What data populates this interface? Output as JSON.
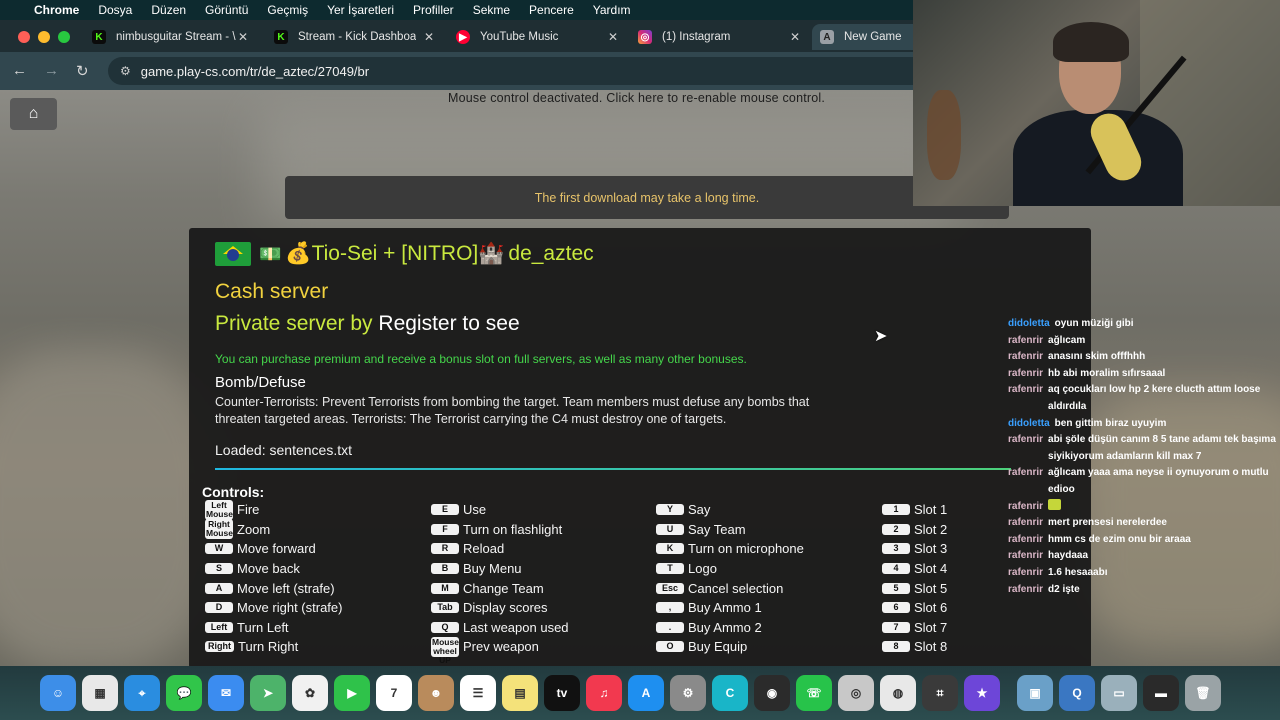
{
  "menubar": {
    "app": "Chrome",
    "items": [
      "Dosya",
      "Düzen",
      "Görüntü",
      "Geçmiş",
      "Yer İşaretleri",
      "Profiller",
      "Sekme",
      "Pencere",
      "Yardım"
    ]
  },
  "tabs": [
    {
      "title": "nimbusguitar Stream - \\",
      "icon": "kick-icon",
      "color": "#53fc18"
    },
    {
      "title": "Stream - Kick Dashboar",
      "icon": "kick-icon",
      "color": "#53fc18"
    },
    {
      "title": "YouTube Music",
      "icon": "youtube-music-icon",
      "color": "#ff0033"
    },
    {
      "title": "(1) Instagram",
      "icon": "instagram-icon",
      "color": "#d62976"
    },
    {
      "title": "New Game",
      "icon": "game-icon",
      "color": "#9aa0a6"
    }
  ],
  "address": {
    "url": "game.play-cs.com/tr/de_aztec/27049/br"
  },
  "game": {
    "mouse_note": "Mouse control deactivated. Click here to re-enable mouse control.",
    "download_banner": "The first download may take a long time.",
    "server_title_prefix": "💰Tio-Sei + [NITRO]🏰",
    "server_title_map": "de_aztec",
    "cash_server": "Cash server",
    "private_prefix": "Private server by",
    "private_register": "Register to see",
    "premium_note": "You can purchase premium and receive a bonus slot on full servers, as well as many other bonuses.",
    "mode_title": "Bomb/Defuse",
    "mode_desc": "Counter-Terrorists: Prevent Terrorists from bombing the target. Team members must defuse any bombs that threaten targeted areas. Terrorists: The Terrorist carrying the C4 must destroy one of targets.",
    "loaded": "Loaded: sentences.txt",
    "controls_title": "Controls:"
  },
  "controls": {
    "col1": [
      {
        "key": "Left Mouse",
        "label": "Fire",
        "tall": true
      },
      {
        "key": "Right Mouse",
        "label": "Zoom",
        "tall": true
      },
      {
        "key": "W",
        "label": "Move forward"
      },
      {
        "key": "S",
        "label": "Move back"
      },
      {
        "key": "A",
        "label": "Move left (strafe)"
      },
      {
        "key": "D",
        "label": "Move right (strafe)"
      },
      {
        "key": "Left",
        "label": "Turn Left"
      },
      {
        "key": "Right",
        "label": "Turn Right"
      }
    ],
    "col2": [
      {
        "key": "E",
        "label": "Use"
      },
      {
        "key": "F",
        "label": "Turn on flashlight"
      },
      {
        "key": "R",
        "label": "Reload"
      },
      {
        "key": "B",
        "label": "Buy Menu"
      },
      {
        "key": "M",
        "label": "Change Team"
      },
      {
        "key": "Tab",
        "label": "Display scores"
      },
      {
        "key": "Q",
        "label": "Last weapon used"
      },
      {
        "key": "Mouse wheel UP",
        "label": "Prev weapon",
        "tall": true
      }
    ],
    "col3": [
      {
        "key": "Y",
        "label": "Say"
      },
      {
        "key": "U",
        "label": "Say Team"
      },
      {
        "key": "K",
        "label": "Turn on microphone"
      },
      {
        "key": "T",
        "label": "Logo"
      },
      {
        "key": "Esc",
        "label": "Cancel selection"
      },
      {
        "key": ",",
        "label": "Buy Ammo 1"
      },
      {
        "key": ".",
        "label": "Buy Ammo 2"
      },
      {
        "key": "O",
        "label": "Buy Equip"
      }
    ],
    "col4": [
      {
        "key": "1",
        "label": "Slot 1"
      },
      {
        "key": "2",
        "label": "Slot 2"
      },
      {
        "key": "3",
        "label": "Slot 3"
      },
      {
        "key": "4",
        "label": "Slot 4"
      },
      {
        "key": "5",
        "label": "Slot 5"
      },
      {
        "key": "6",
        "label": "Slot 6"
      },
      {
        "key": "7",
        "label": "Slot 7"
      },
      {
        "key": "8",
        "label": "Slot 8"
      }
    ]
  },
  "chat": [
    {
      "user": "didoletta",
      "text": "oyun müziği gibi",
      "color": "blue"
    },
    {
      "user": "rafenrir",
      "text": "ağlıcam",
      "color": "pink"
    },
    {
      "user": "rafenrir",
      "text": "anasını skim offfhhh",
      "color": "pink"
    },
    {
      "user": "rafenrir",
      "text": "hb abi moralim sıfırsaaal",
      "color": "pink"
    },
    {
      "user": "rafenrir",
      "text": "aq çocukları low hp 2 kere clucth attım loose aldırdıla",
      "color": "pink"
    },
    {
      "user": "didoletta",
      "text": "ben gittim biraz uyuyim",
      "color": "blue"
    },
    {
      "user": "rafenrir",
      "text": "abi şöle düşün canım 8 5 tane adamı tek başıma siyikiyorum adamların kill max 7",
      "color": "pink"
    },
    {
      "user": "rafenrir",
      "text": "ağlıcam yaaa ama neyse ii oynuyorum o mutlu edioo",
      "color": "pink"
    },
    {
      "user": "rafenrir",
      "text": "",
      "color": "pink",
      "emote": true
    },
    {
      "user": "rafenrir",
      "text": "mert prensesi nerelerdee",
      "color": "pink"
    },
    {
      "user": "rafenrir",
      "text": "hmm cs de ezim onu bir araaa",
      "color": "pink"
    },
    {
      "user": "rafenrir",
      "text": "haydaaa",
      "color": "pink"
    },
    {
      "user": "rafenrir",
      "text": "1.6 hesaaabı",
      "color": "pink"
    },
    {
      "user": "rafenrir",
      "text": "d2 işte",
      "color": "pink"
    }
  ],
  "dock": [
    {
      "name": "finder-icon",
      "color": "#3d8ee8",
      "glyph": "☺"
    },
    {
      "name": "launchpad-icon",
      "color": "#e8e8e8",
      "glyph": "▦"
    },
    {
      "name": "safari-icon",
      "color": "#2a8de0",
      "glyph": "⌖"
    },
    {
      "name": "messages-icon",
      "color": "#31c54a",
      "glyph": "💬"
    },
    {
      "name": "mail-icon",
      "color": "#3b8cf0",
      "glyph": "✉"
    },
    {
      "name": "maps-icon",
      "color": "#4db36a",
      "glyph": "➤"
    },
    {
      "name": "photos-icon",
      "color": "#f1f1f1",
      "glyph": "✿"
    },
    {
      "name": "facetime-icon",
      "color": "#2fc24a",
      "glyph": "▶"
    },
    {
      "name": "calendar-icon",
      "color": "#ffffff",
      "glyph": "7"
    },
    {
      "name": "contacts-icon",
      "color": "#b98b5c",
      "glyph": "☻"
    },
    {
      "name": "reminders-icon",
      "color": "#ffffff",
      "glyph": "☰"
    },
    {
      "name": "notes-icon",
      "color": "#f4e27a",
      "glyph": "▤"
    },
    {
      "name": "tv-icon",
      "color": "#111111",
      "glyph": "tv"
    },
    {
      "name": "music-icon",
      "color": "#f2394f",
      "glyph": "♫"
    },
    {
      "name": "appstore-icon",
      "color": "#1e8ff0",
      "glyph": "A"
    },
    {
      "name": "settings-icon",
      "color": "#8a8a8a",
      "glyph": "⚙"
    },
    {
      "name": "canva-icon",
      "color": "#19b5c8",
      "glyph": "C"
    },
    {
      "name": "obs-icon",
      "color": "#2b2b2b",
      "glyph": "◉"
    },
    {
      "name": "whatsapp-icon",
      "color": "#27c34a",
      "glyph": "☏"
    },
    {
      "name": "steam-icon",
      "color": "#c8c8c8",
      "glyph": "◎"
    },
    {
      "name": "chrome-icon",
      "color": "#e8e8e8",
      "glyph": "◍"
    },
    {
      "name": "calculator-icon",
      "color": "#3a3a3a",
      "glyph": "⌗"
    },
    {
      "name": "imovie-icon",
      "color": "#6d46d8",
      "glyph": "★"
    }
  ],
  "dock_right": [
    {
      "name": "downloads-stack-icon",
      "color": "#6aa0c8",
      "glyph": "▣"
    },
    {
      "name": "quicktime-icon",
      "color": "#3a77c2",
      "glyph": "Q"
    },
    {
      "name": "screenshot-stack-icon",
      "color": "#9ab0bb",
      "glyph": "▭"
    },
    {
      "name": "window-stack-icon",
      "color": "#2a2a2a",
      "glyph": "▬"
    },
    {
      "name": "trash-icon",
      "color": "#9aa3a6",
      "glyph": "🗑"
    }
  ]
}
